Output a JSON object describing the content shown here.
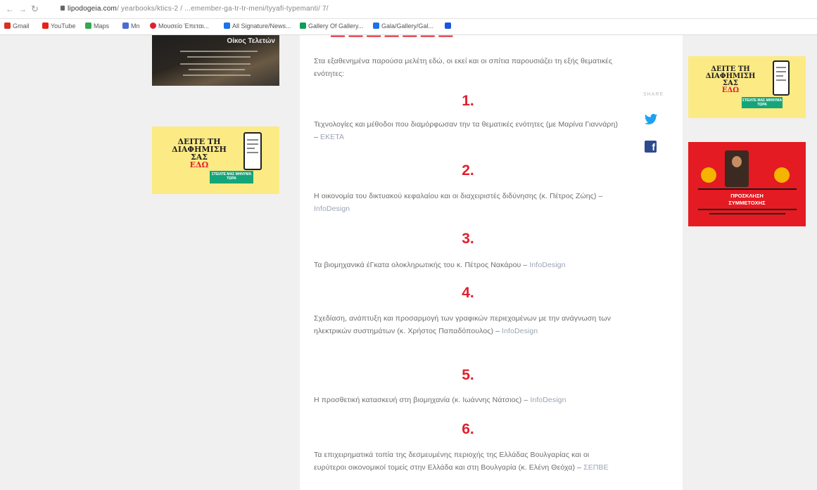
{
  "browser": {
    "url_domain": "lipodogeia.com",
    "url_rest": "/ yearbooks/ktics-2 / ...emember-ga-tr-tr-meni/tyyafi-typemanti/ 7/",
    "bookmarks": [
      "Gmail",
      "YouTube",
      "Maps",
      "Mn",
      "Μουσείο Έπεται...",
      "All Signature/News...",
      "Gallery Of Gallery...",
      "Gala/Gallery/Gal...",
      ""
    ]
  },
  "left_ads": {
    "dark_title": "Οίκος Τελετών",
    "yellow": {
      "line1": "ΔΕΙΤΕ ΤΗ",
      "line2": "ΔΙΑΦΗΜΙΣΗ",
      "line3": "ΣΑΣ",
      "line4": "ΕΔΩ",
      "cta": "ΣΤΕΙΛΤΕ ΜΑΣ ΜΗΝΥΜΑ ΤΩΡΑ"
    }
  },
  "article": {
    "header_fragment": "— — — — — — —",
    "intro": "Στα εξαθενημένα παρούσα μελέτη εδώ, οι εκεί και οι σπίτια παρουσιάζει τη εξής θεματικές ενότητες:",
    "sections": [
      {
        "num": "1.",
        "text": "Τεχνολογίες και μέθοδοι που διαμόρφωσαν την τα θεματικές ενότητες (με Μαρίνα Γιαννάρη) –",
        "link": "ΕΚΕΤΑ"
      },
      {
        "num": "2.",
        "text": "Η οικονομία του δικτυακού κεφαλαίου και οι διαχειριστές διδύνησης (κ. Πέτρος Ζώης) –",
        "link": "InfoDesign"
      },
      {
        "num": "3.",
        "text": "Τα βιομηχανικά έΓκατα ολοκληρωτικής του κ. Πέτρος Νακάρου –",
        "link": "InfoDesign"
      },
      {
        "num": "4.",
        "text": "Σχεδίαση, ανάπτυξη και προσαρμογή των γραφικών περιεχομένων με την ανάγνωση των ηλεκτρικών συστημάτων (κ. Χρήστος Παπαδόπουλος) –",
        "link": "InfoDesign"
      },
      {
        "num": "5.",
        "text": "Η προσθετική κατασκευή στη βιομηχανία (κ. Ιωάννης Νάτσιος) –",
        "link": "InfoDesign"
      },
      {
        "num": "6.",
        "text": "Τα επιχειρηματικά τοπία της δεσμευμένης περιοχής της Ελλάδας Βουλγαρίας και οι ευρύτεροι οικονομικοί τομείς στην Ελλάδα και στη Βουλγαρία (κ. Ελένη Θεόχα) –",
        "link": "ΣΕΠΒΕ"
      }
    ]
  },
  "share": {
    "label": "SHARE"
  },
  "right_ads": {
    "yellow": {
      "line1": "ΔΕΙΤΕ ΤΗ",
      "line2": "ΔΙΑΦΗΜΙΣΗ",
      "line3": "ΣΑΣ",
      "line4": "ΕΔΩ",
      "cta": "ΣΤΕΙΛΤΕ ΜΑΣ ΜΗΝΥΜΑ ΤΩΡΑ"
    },
    "red": {
      "line1": "ΠΡΟΣΚΛΗΣΗ",
      "line2": "ΣΥΜΜΕΤΟΧΗΣ"
    }
  },
  "colors": {
    "accent": "#e0202e",
    "twitter": "#1da1f2",
    "facebook": "#2d4b8e",
    "ad_yellow": "#fcea85",
    "ad_red": "#e41b22"
  }
}
